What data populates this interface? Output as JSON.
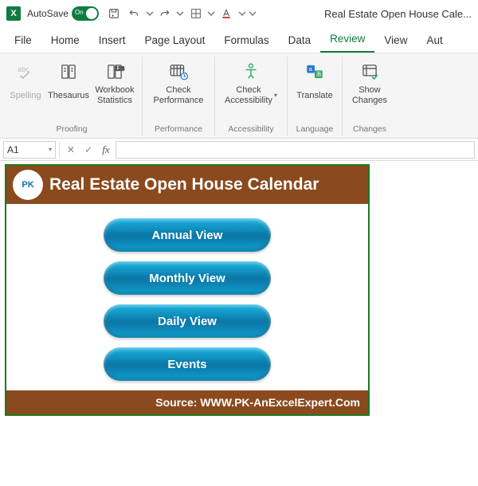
{
  "titlebar": {
    "autosave_label": "AutoSave",
    "autosave_on_text": "On",
    "doc_title": "Real Estate Open House Cale..."
  },
  "tabs": {
    "file": "File",
    "home": "Home",
    "insert": "Insert",
    "page_layout": "Page Layout",
    "formulas": "Formulas",
    "data": "Data",
    "review": "Review",
    "view": "View",
    "aut": "Aut"
  },
  "ribbon": {
    "proofing": {
      "label": "Proofing",
      "spelling": "Spelling",
      "thesaurus": "Thesaurus",
      "workbook_stats": "Workbook\nStatistics"
    },
    "performance": {
      "label": "Performance",
      "check_performance": "Check\nPerformance"
    },
    "accessibility": {
      "label": "Accessibility",
      "check_accessibility": "Check\nAccessibility"
    },
    "language": {
      "label": "Language",
      "translate": "Translate"
    },
    "changes": {
      "label": "Changes",
      "show_changes": "Show\nChanges"
    }
  },
  "formulabar": {
    "namebox_value": "A1",
    "formula_value": ""
  },
  "dashboard": {
    "title": "Real Estate Open House Calendar",
    "buttons": {
      "annual": "Annual View",
      "monthly": "Monthly View",
      "daily": "Daily View",
      "events": "Events"
    },
    "footer_label": "Source: WWW.PK-AnExcelExpert.Com"
  }
}
